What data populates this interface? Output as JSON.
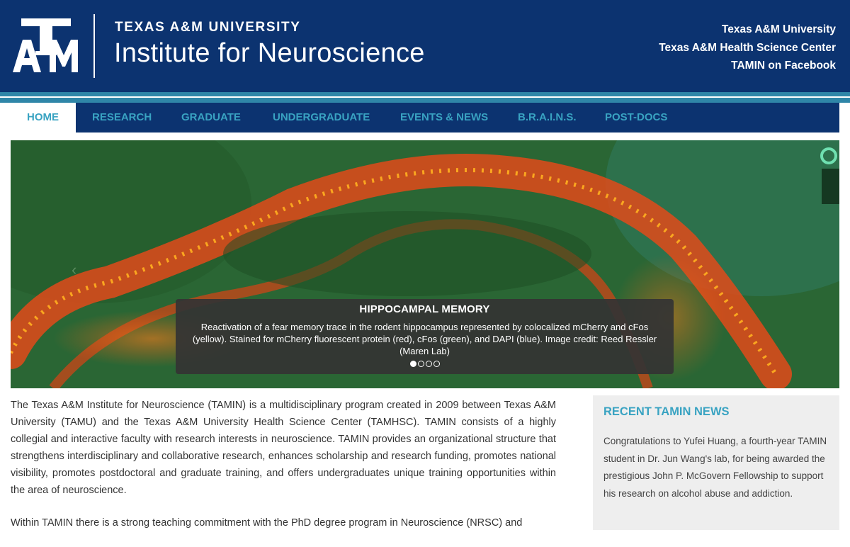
{
  "header": {
    "logo_text": "ATM",
    "university": "TEXAS A&M UNIVERSITY",
    "institute": "Institute for Neuroscience",
    "links": [
      "Texas A&M University",
      "Texas A&M Health Science Center",
      "TAMIN on Facebook"
    ]
  },
  "nav": {
    "items": [
      "HOME",
      "RESEARCH",
      "GRADUATE",
      "UNDERGRADUATE",
      "EVENTS & NEWS",
      "B.R.A.I.N.S.",
      "POST-DOCS"
    ],
    "active": "HOME"
  },
  "hero": {
    "prev_icon": "‹",
    "caption_title": "HIPPOCAMPAL MEMORY",
    "caption_text": "Reactivation of a fear memory trace in the rodent hippocampus represented by colocalized mCherry and cFos (yellow). Stained for mCherry fluorescent protein (red), cFos (green), and DAPI (blue). Image credit: Reed Ressler (Maren Lab)",
    "slide_count": 4,
    "active_slide": 1
  },
  "intro": {
    "paragraph1": "The Texas A&M Institute for Neuroscience (TAMIN) is a multidisciplinary program created in 2009 between Texas A&M University (TAMU) and the Texas A&M University Health Science Center (TAMHSC). TAMIN consists of a highly collegial and interactive faculty with research interests in neuroscience. TAMIN provides an organizational structure that strengthens interdisciplinary and collaborative research, enhances scholarship and research funding, promotes national visibility, promotes postdoctoral and graduate training, and offers undergraduates unique training opportunities within the area of neuroscience.",
    "paragraph2": "Within TAMIN there is a strong teaching commitment with the PhD degree program in Neuroscience (NRSC) and"
  },
  "sidebar": {
    "title": "RECENT TAMIN NEWS",
    "news_text": "Congratulations to Yufei Huang, a fourth-year TAMIN student in Dr. Jun Wang's lab, for being awarded the prestigious John P. McGovern Fellowship to support his research on alcohol abuse and addiction."
  },
  "colors": {
    "header_bg": "#0c3370",
    "accent": "#39a3c2",
    "stripe": "#2f86a8"
  }
}
